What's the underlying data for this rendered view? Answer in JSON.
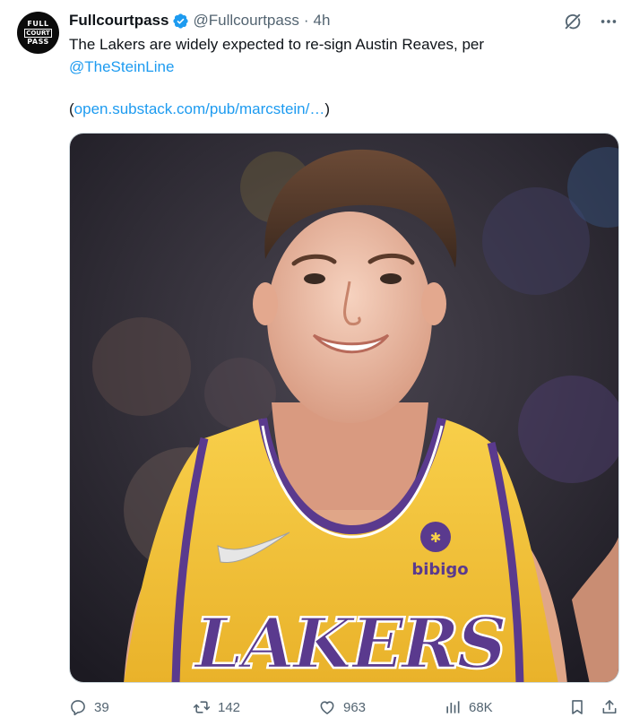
{
  "author": {
    "avatar_lines": [
      "FULL",
      "COURT",
      "PASS"
    ],
    "name": "Fullcourtpass",
    "handle": "@Fullcourtpass",
    "separator": "·",
    "time": "4h"
  },
  "tweet": {
    "text": "The Lakers are widely expected to re-sign Austin Reaves, per",
    "mention": "@TheSteinLine",
    "link_open": "(",
    "link": "open.substack.com/pub/marcstein/…",
    "link_close": ")"
  },
  "media": {
    "jersey_text": "LAKERS",
    "sponsor_text": "bibigo"
  },
  "actions": {
    "replies": "39",
    "retweets": "142",
    "likes": "963",
    "views": "68K"
  },
  "colors": {
    "link": "#1d9bf0",
    "muted": "#536471",
    "verified": "#1d9bf0",
    "lakers_gold": "#f5c43a",
    "lakers_purple": "#5a3a8e"
  }
}
